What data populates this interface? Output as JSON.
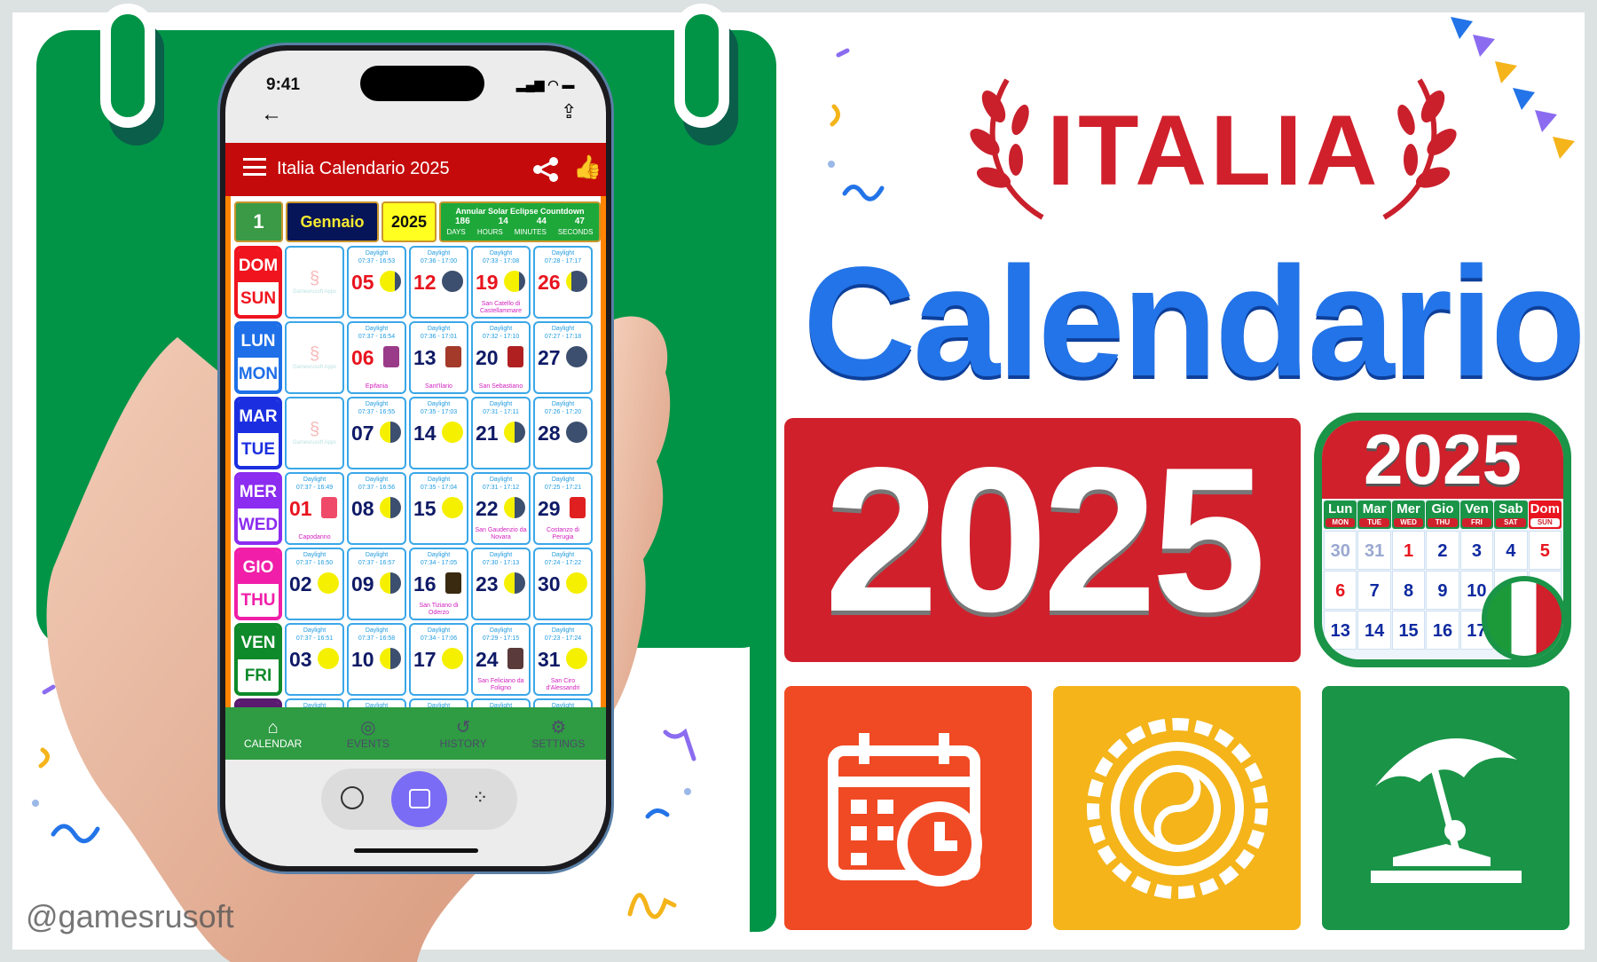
{
  "colors": {
    "green": "#019447",
    "red": "#c40a0a",
    "blue": "#2374e8",
    "italia_red": "#d0202c",
    "tile_orange": "#f04a24",
    "tile_yellow": "#f4b41a",
    "tile_green": "#1a9447"
  },
  "phone": {
    "status_time": "9:41",
    "app_title": "Italia Calendario 2025",
    "header": {
      "day": "1",
      "month": "Gennaio",
      "year": "2025",
      "countdown": {
        "title": "Annular Solar Eclipse Countdown",
        "days": "186",
        "hours": "14",
        "minutes": "44",
        "seconds": "47",
        "days_label": "DAYS",
        "hours_label": "HOURS",
        "minutes_label": "MINUTES",
        "seconds_label": "SECONDS"
      }
    },
    "daylight_label": "Daylight",
    "logo_text": "Gamesrusoft Apps",
    "rows": [
      {
        "it": "DOM",
        "en": "SUN",
        "color": "#f0141e",
        "date_color": "#e8141e",
        "cells": [
          null,
          {
            "d": "05",
            "t": "07:37 - 16:53",
            "moon": "first"
          },
          {
            "d": "12",
            "t": "07:36 - 17:00",
            "moon": "new"
          },
          {
            "d": "19",
            "t": "07:33 - 17:08",
            "moon": "first",
            "h": "San Catello di Castellammare"
          },
          {
            "d": "26",
            "t": "07:28 - 17:17",
            "moon": "crescent"
          }
        ]
      },
      {
        "it": "LUN",
        "en": "MON",
        "color": "#1e6fe8",
        "cells": [
          null,
          {
            "d": "06",
            "t": "07:37 - 16:54",
            "ev": "#9a3b8a",
            "h": "Epifania",
            "red": true
          },
          {
            "d": "13",
            "t": "07:36 - 17:01",
            "ev": "#a33a2a",
            "h": "Sant'Ilario"
          },
          {
            "d": "20",
            "t": "07:32 - 17:10",
            "ev": "#b02020",
            "h": "San Sebastiano"
          },
          {
            "d": "27",
            "t": "07:27 - 17:18",
            "moon": "new"
          }
        ]
      },
      {
        "it": "MAR",
        "en": "TUE",
        "color": "#1c2fe0",
        "cells": [
          null,
          {
            "d": "07",
            "t": "07:37 - 16:55",
            "moon": "half"
          },
          {
            "d": "14",
            "t": "07:35 - 17:03",
            "moon": "full"
          },
          {
            "d": "21",
            "t": "07:31 - 17:11",
            "moon": "half"
          },
          {
            "d": "28",
            "t": "07:26 - 17:20",
            "moon": "new"
          }
        ]
      },
      {
        "it": "MER",
        "en": "WED",
        "color": "#8b2cf0",
        "cells": [
          {
            "d": "01",
            "t": "07:37 - 16:49",
            "ev": "#f04a6a",
            "h": "Capodanno",
            "red": true
          },
          {
            "d": "08",
            "t": "07:37 - 16:56",
            "moon": "half"
          },
          {
            "d": "15",
            "t": "07:35 - 17:04",
            "moon": "full"
          },
          {
            "d": "22",
            "t": "07:31 - 17:12",
            "moon": "half",
            "h": "San Gaudenzio da Novara"
          },
          {
            "d": "29",
            "t": "07:25 - 17:21",
            "ev": "#e02020",
            "h": "Costanzo di Perugia"
          }
        ]
      },
      {
        "it": "GIO",
        "en": "THU",
        "color": "#f01ea8",
        "cells": [
          {
            "d": "02",
            "t": "07:37 - 16:50",
            "moon": "full"
          },
          {
            "d": "09",
            "t": "07:37 - 16:57",
            "moon": "half"
          },
          {
            "d": "16",
            "t": "07:34 - 17:05",
            "ev": "#3a2a10",
            "h": "San Tiziano di Oderzo"
          },
          {
            "d": "23",
            "t": "07:30 - 17:13",
            "moon": "half"
          },
          {
            "d": "30",
            "t": "07:24 - 17:22",
            "moon": "full"
          }
        ]
      },
      {
        "it": "VEN",
        "en": "FRI",
        "color": "#0f8a2a",
        "cells": [
          {
            "d": "03",
            "t": "07:37 - 16:51",
            "moon": "full"
          },
          {
            "d": "10",
            "t": "07:37 - 16:58",
            "moon": "half"
          },
          {
            "d": "17",
            "t": "07:34 - 17:06",
            "moon": "full"
          },
          {
            "d": "24",
            "t": "07:29 - 17:15",
            "ev": "#5a3a3a",
            "h": "San Feliciano da Foligno"
          },
          {
            "d": "31",
            "t": "07:23 - 17:24",
            "moon": "full",
            "h": "San Ciro d'Alessandri"
          }
        ]
      },
      {
        "it": "",
        "en": "",
        "color": "#5a1a70",
        "cells": [
          {
            "d": "",
            "t": ""
          },
          {
            "d": "",
            "t": ""
          },
          {
            "d": "",
            "t": ""
          },
          {
            "d": "",
            "t": ""
          },
          {
            "d": "",
            "t": ""
          }
        ]
      }
    ],
    "nav": [
      {
        "label": "CALENDAR",
        "icon": "home-icon",
        "active": true
      },
      {
        "label": "EVENTS",
        "icon": "events-icon"
      },
      {
        "label": "HISTORY",
        "icon": "history-icon"
      },
      {
        "label": "SETTINGS",
        "icon": "settings-icon"
      }
    ]
  },
  "hero": {
    "italia": "ITALIA",
    "calendario": "Calendario",
    "year": "2025"
  },
  "app_icon": {
    "year": "2025",
    "days_it": [
      "Lun",
      "Mar",
      "Mer",
      "Gio",
      "Ven",
      "Sab",
      "Dom"
    ],
    "days_en": [
      "MON",
      "TUE",
      "WED",
      "THU",
      "FRI",
      "SAT",
      "SUN"
    ],
    "dates": [
      "30",
      "31",
      "1",
      "2",
      "3",
      "4",
      "5",
      "6",
      "7",
      "8",
      "9",
      "10",
      "",
      "",
      "13",
      "14",
      "15",
      "16",
      "17",
      "",
      ""
    ]
  },
  "watermark": "@gamesrusoft"
}
